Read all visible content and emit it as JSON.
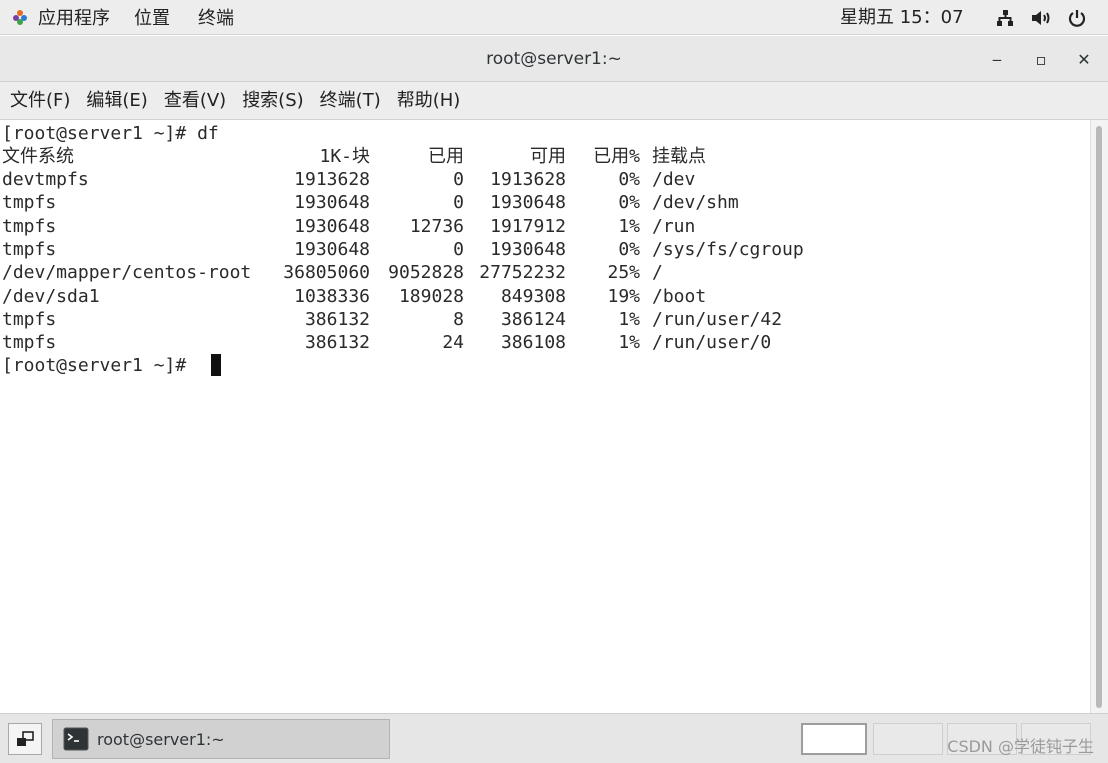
{
  "top_panel": {
    "apps_label": "应用程序",
    "places_label": "位置",
    "terminal_label": "终端",
    "clock": "星期五 15：07",
    "icons": [
      "network-icon",
      "volume-icon",
      "power-icon"
    ]
  },
  "window": {
    "title": "root@server1:~",
    "minimize_glyph": "‒",
    "maximize_glyph": "▫",
    "close_glyph": "✕"
  },
  "menu_bar": {
    "items": [
      "文件(F)",
      "编辑(E)",
      "查看(V)",
      "搜索(S)",
      "终端(T)",
      "帮助(H)"
    ]
  },
  "terminal": {
    "prompt_command": "[root@server1 ~]# df",
    "header": {
      "filesystem": "文件系统",
      "blocks": "1K-块",
      "used": "已用",
      "available": "可用",
      "use_pct": "已用%",
      "mounted_on": "挂载点"
    },
    "rows": [
      {
        "fs": "devtmpfs",
        "blocks": "1913628",
        "used": "0",
        "avail": "1913628",
        "pct": "0%",
        "mount": "/dev"
      },
      {
        "fs": "tmpfs",
        "blocks": "1930648",
        "used": "0",
        "avail": "1930648",
        "pct": "0%",
        "mount": "/dev/shm"
      },
      {
        "fs": "tmpfs",
        "blocks": "1930648",
        "used": "12736",
        "avail": "1917912",
        "pct": "1%",
        "mount": "/run"
      },
      {
        "fs": "tmpfs",
        "blocks": "1930648",
        "used": "0",
        "avail": "1930648",
        "pct": "0%",
        "mount": "/sys/fs/cgroup"
      },
      {
        "fs": "/dev/mapper/centos-root",
        "blocks": "36805060",
        "used": "9052828",
        "avail": "27752232",
        "pct": "25%",
        "mount": "/"
      },
      {
        "fs": "/dev/sda1",
        "blocks": "1038336",
        "used": "189028",
        "avail": "849308",
        "pct": "19%",
        "mount": "/boot"
      },
      {
        "fs": "tmpfs",
        "blocks": "386132",
        "used": "8",
        "avail": "386124",
        "pct": "1%",
        "mount": "/run/user/42"
      },
      {
        "fs": "tmpfs",
        "blocks": "386132",
        "used": "24",
        "avail": "386108",
        "pct": "1%",
        "mount": "/run/user/0"
      }
    ],
    "final_prompt": "[root@server1 ~]# "
  },
  "taskbar": {
    "task_label": "root@server1:~",
    "watermark": "CSDN @学徒钝子生"
  },
  "colors": {
    "panel_bg": "#ededed",
    "terminal_bg": "#ffffff",
    "terminal_fg": "#2a2a2a"
  }
}
